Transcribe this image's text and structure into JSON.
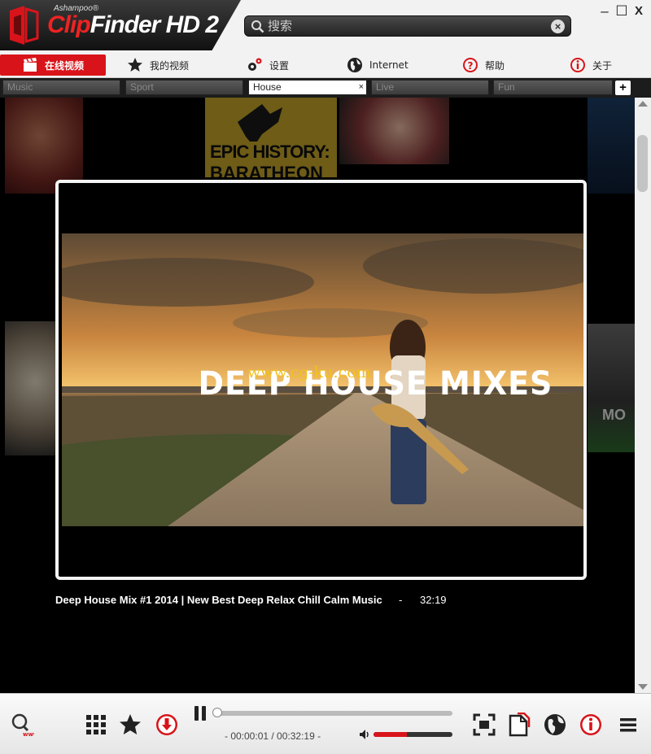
{
  "app": {
    "brand": "Ashampoo®",
    "name_clip": "Clip",
    "name_rest": "Finder HD 2",
    "accent_color": "#d8141a"
  },
  "search": {
    "placeholder": "搜索",
    "value": ""
  },
  "window_controls": {
    "minimize": "–",
    "maximize": "☐",
    "close": "X"
  },
  "nav": {
    "items": [
      {
        "label": "在线视频",
        "icon": "clapperboard-icon",
        "active": true
      },
      {
        "label": "我的视频",
        "icon": "star-icon"
      },
      {
        "label": "设置",
        "icon": "gears-icon"
      },
      {
        "label": "Internet",
        "icon": "globe-icon"
      },
      {
        "label": "帮助",
        "icon": "help-icon"
      },
      {
        "label": "关于",
        "icon": "info-icon"
      }
    ]
  },
  "tabs": {
    "items": [
      {
        "label": "Music"
      },
      {
        "label": "Sport"
      },
      {
        "label": "House",
        "active": true,
        "close": "×"
      },
      {
        "label": "Live"
      },
      {
        "label": "Fun"
      }
    ],
    "add_label": "+"
  },
  "background_thumbs": {
    "epic_history_text": "EPIC HISTORY:",
    "epic_history_sub": "BARATHEON",
    "right_thumb_text": "MO"
  },
  "video": {
    "overlay_text": "DEEP HOUSE MIXES",
    "watermark": "www.cg-ku.com",
    "title": "Deep House Mix #1 2014 | New Best Deep Relax Chill Calm Music",
    "separator": "-",
    "duration": "32:19"
  },
  "player": {
    "time_readout": "- 00:00:01 / 00:32:19 -",
    "progress": 0.0,
    "volume": 0.42
  },
  "bottom_icons": [
    "search-www-icon",
    "grid-icon",
    "star-icon",
    "download-icon",
    "pause-icon",
    "fullscreen-icon",
    "document-icon",
    "globe-icon",
    "info-icon",
    "menu-icon"
  ]
}
